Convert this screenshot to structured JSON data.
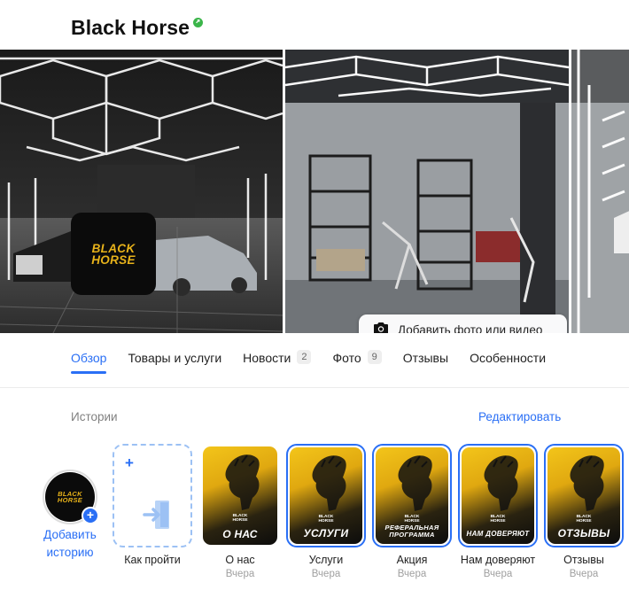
{
  "business": {
    "name": "Black Horse",
    "verified_icon": "verified-check-icon",
    "verified_color": "#3bb54a"
  },
  "logo": {
    "line1": "BLACK",
    "line2": "HORSE",
    "color": "#e7b21a"
  },
  "gallery": {
    "add_media_label": "Добавить фото или видео",
    "add_media_icon": "camera-icon"
  },
  "tabs": [
    {
      "label": "Обзор",
      "count": null,
      "active": true
    },
    {
      "label": "Товары и услуги",
      "count": null,
      "active": false
    },
    {
      "label": "Новости",
      "count": "2",
      "active": false
    },
    {
      "label": "Фото",
      "count": "9",
      "active": false
    },
    {
      "label": "Отзывы",
      "count": null,
      "active": false
    },
    {
      "label": "Особенности",
      "count": null,
      "active": false
    }
  ],
  "stories": {
    "title": "Истории",
    "edit_label": "Редактировать",
    "add_story_label": "Добавить историю",
    "howto_label": "Как пройти",
    "items": [
      {
        "caption": "О НАС",
        "label": "О нас",
        "time": "Вчера"
      },
      {
        "caption": "УСЛУГИ",
        "label": "Услуги",
        "time": "Вчера"
      },
      {
        "caption": "РЕФЕРАЛЬНАЯ ПРОГРАММА",
        "label": "Акция",
        "time": "Вчера"
      },
      {
        "caption": "НАМ ДОВЕРЯЮТ",
        "label": "Нам доверяют",
        "time": "Вчера"
      },
      {
        "caption": "ОТЗЫВЫ",
        "label": "Отзывы",
        "time": "Вчера"
      }
    ]
  },
  "accent_color": "#2a6ff5"
}
